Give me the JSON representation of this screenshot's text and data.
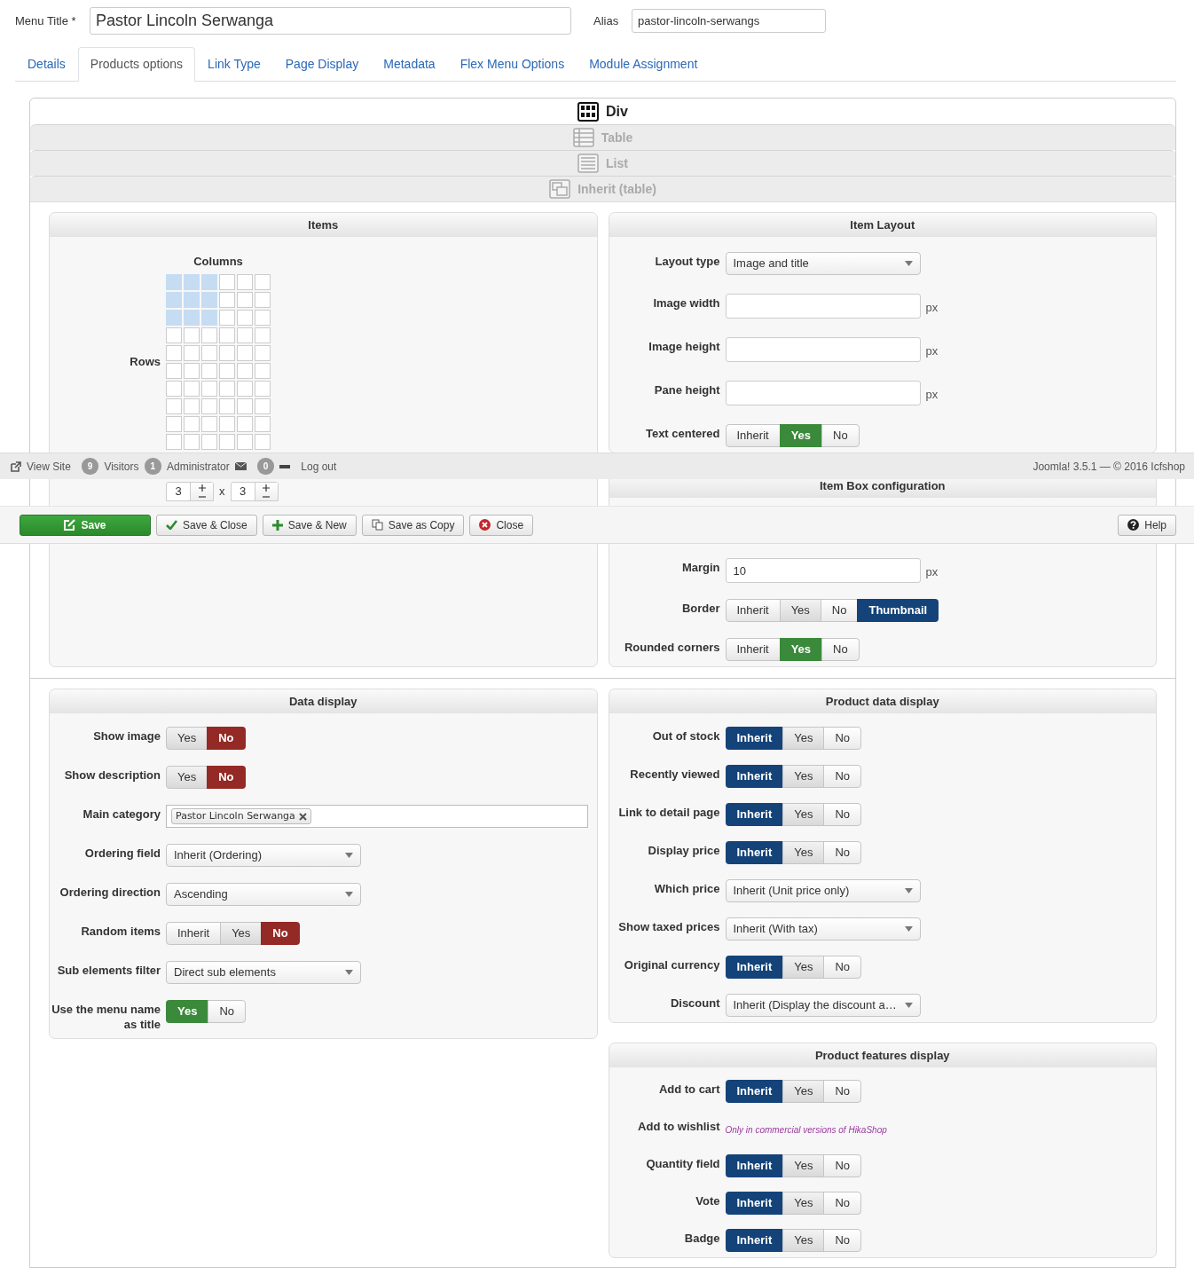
{
  "menu_title": {
    "label": "Menu Title *",
    "value": "Pastor Lincoln Serwanga"
  },
  "alias": {
    "label": "Alias",
    "value": "pastor-lincoln-serwangs"
  },
  "tabs": [
    {
      "label": "Details",
      "selected": false
    },
    {
      "label": "Products options",
      "selected": true
    },
    {
      "label": "Link Type",
      "selected": false
    },
    {
      "label": "Page Display",
      "selected": false
    },
    {
      "label": "Metadata",
      "selected": false
    },
    {
      "label": "Flex Menu Options",
      "selected": false
    },
    {
      "label": "Module Assignment",
      "selected": false
    }
  ],
  "layout_options": [
    {
      "kind": "div",
      "label": "Div",
      "selected": true
    },
    {
      "kind": "table",
      "label": "Table",
      "selected": false
    },
    {
      "kind": "list",
      "label": "List",
      "selected": false
    },
    {
      "kind": "inherit",
      "label": "Inherit (table)",
      "selected": false
    }
  ],
  "items_panel": {
    "title": "Items",
    "columns_label": "Columns",
    "rows_label": "Rows",
    "rows_value": "3",
    "times": "x",
    "columns_value": "3"
  },
  "item_layout": {
    "title": "Item Layout",
    "fields": [
      {
        "kind": "select",
        "label": "Layout type",
        "value": "Image and title"
      },
      {
        "kind": "text",
        "label": "Image width",
        "unit": "px"
      },
      {
        "kind": "text",
        "label": "Image height",
        "unit": "px"
      },
      {
        "kind": "text",
        "label": "Pane height",
        "unit": "px"
      },
      {
        "kind": "toggle",
        "label": "Text centered",
        "options": [
          {
            "label": "Inherit",
            "kind": "inherit",
            "selected": false
          },
          {
            "label": "Yes",
            "kind": "yes",
            "selected": true
          },
          {
            "label": "No",
            "kind": "no",
            "selected": false
          }
        ]
      }
    ]
  },
  "item_box": {
    "title": "Item Box configuration",
    "fields": [
      {
        "kind": "text",
        "label": "Margin",
        "value": "10",
        "unit": "px"
      },
      {
        "kind": "toggle",
        "label": "Border",
        "options": [
          {
            "label": "Inherit",
            "kind": "inherit",
            "selected": false
          },
          {
            "label": "Yes",
            "kind": "yes",
            "selected": false
          },
          {
            "label": "No",
            "kind": "no",
            "selected": false
          },
          {
            "label": "Thumbnail",
            "kind": "inherit",
            "selected": true
          }
        ]
      },
      {
        "kind": "toggle",
        "label": "Rounded corners",
        "options": [
          {
            "label": "Inherit",
            "kind": "inherit",
            "selected": false
          },
          {
            "label": "Yes",
            "kind": "yes",
            "selected": true
          },
          {
            "label": "No",
            "kind": "no",
            "selected": false
          }
        ]
      }
    ]
  },
  "data_display": {
    "title": "Data display",
    "fields": [
      {
        "kind": "toggle",
        "label": "Show image",
        "options": [
          {
            "label": "Yes",
            "kind": "yes",
            "selected": false
          },
          {
            "label": "No",
            "kind": "no",
            "selected": true
          }
        ]
      },
      {
        "kind": "toggle",
        "label": "Show description",
        "options": [
          {
            "label": "Yes",
            "kind": "yes",
            "selected": false
          },
          {
            "label": "No",
            "kind": "no",
            "selected": true
          }
        ]
      },
      {
        "kind": "tags",
        "label": "Main category",
        "tags": [
          "Pastor Lincoln Serwanga"
        ]
      },
      {
        "kind": "select",
        "label": "Ordering field",
        "value": "Inherit (Ordering)"
      },
      {
        "kind": "select",
        "label": "Ordering direction",
        "value": "Ascending"
      },
      {
        "kind": "toggle",
        "label": "Random items",
        "options": [
          {
            "label": "Inherit",
            "kind": "inherit",
            "selected": false
          },
          {
            "label": "Yes",
            "kind": "yes",
            "selected": false
          },
          {
            "label": "No",
            "kind": "no",
            "selected": true
          }
        ]
      },
      {
        "kind": "select",
        "label": "Sub elements filter",
        "value": "Direct sub elements"
      },
      {
        "kind": "toggle",
        "label": "Use the menu name as title",
        "options": [
          {
            "label": "Yes",
            "kind": "yes",
            "selected": true
          },
          {
            "label": "No",
            "kind": "no",
            "selected": false
          }
        ]
      }
    ]
  },
  "product_data_display": {
    "title": "Product data display",
    "fields": [
      {
        "kind": "toggle",
        "label": "Out of stock",
        "options": [
          {
            "label": "Inherit",
            "kind": "inherit",
            "selected": true
          },
          {
            "label": "Yes",
            "kind": "yes",
            "selected": false
          },
          {
            "label": "No",
            "kind": "no",
            "selected": false
          }
        ]
      },
      {
        "kind": "toggle",
        "label": "Recently viewed",
        "options": [
          {
            "label": "Inherit",
            "kind": "inherit",
            "selected": true
          },
          {
            "label": "Yes",
            "kind": "yes",
            "selected": false
          },
          {
            "label": "No",
            "kind": "no",
            "selected": false
          }
        ]
      },
      {
        "kind": "toggle",
        "label": "Link to detail page",
        "options": [
          {
            "label": "Inherit",
            "kind": "inherit",
            "selected": true
          },
          {
            "label": "Yes",
            "kind": "yes",
            "selected": false
          },
          {
            "label": "No",
            "kind": "no",
            "selected": false
          }
        ]
      },
      {
        "kind": "toggle",
        "label": "Display price",
        "options": [
          {
            "label": "Inherit",
            "kind": "inherit",
            "selected": true
          },
          {
            "label": "Yes",
            "kind": "yes",
            "selected": false
          },
          {
            "label": "No",
            "kind": "no",
            "selected": false
          }
        ]
      },
      {
        "kind": "select",
        "label": "Which price",
        "value": "Inherit (Unit price only)"
      },
      {
        "kind": "select",
        "label": "Show taxed prices",
        "value": "Inherit (With tax)"
      },
      {
        "kind": "toggle",
        "label": "Original currency",
        "options": [
          {
            "label": "Inherit",
            "kind": "inherit",
            "selected": true
          },
          {
            "label": "Yes",
            "kind": "yes",
            "selected": false
          },
          {
            "label": "No",
            "kind": "no",
            "selected": false
          }
        ]
      },
      {
        "kind": "select",
        "label": "Discount",
        "value": "Inherit (Display the discount a…"
      }
    ]
  },
  "product_features_display": {
    "title": "Product features display",
    "fields": [
      {
        "kind": "toggle",
        "label": "Add to cart",
        "options": [
          {
            "label": "Inherit",
            "kind": "inherit",
            "selected": true
          },
          {
            "label": "Yes",
            "kind": "yes",
            "selected": false
          },
          {
            "label": "No",
            "kind": "no",
            "selected": false
          }
        ]
      },
      {
        "kind": "note",
        "label": "Add to wishlist",
        "value": "Only in commercial versions of HikaShop"
      },
      {
        "kind": "toggle",
        "label": "Quantity field",
        "options": [
          {
            "label": "Inherit",
            "kind": "inherit",
            "selected": true
          },
          {
            "label": "Yes",
            "kind": "yes",
            "selected": false
          },
          {
            "label": "No",
            "kind": "no",
            "selected": false
          }
        ]
      },
      {
        "kind": "toggle",
        "label": "Vote",
        "options": [
          {
            "label": "Inherit",
            "kind": "inherit",
            "selected": true
          },
          {
            "label": "Yes",
            "kind": "yes",
            "selected": false
          },
          {
            "label": "No",
            "kind": "no",
            "selected": false
          }
        ]
      },
      {
        "kind": "toggle",
        "label": "Badge",
        "options": [
          {
            "label": "Inherit",
            "kind": "inherit",
            "selected": true
          },
          {
            "label": "Yes",
            "kind": "yes",
            "selected": false
          },
          {
            "label": "No",
            "kind": "no",
            "selected": false
          }
        ]
      }
    ]
  },
  "status_bar": {
    "view_site": "View Site",
    "visitors_count": "9",
    "visitors_label": "Visitors",
    "admins_count": "1",
    "admins_label": "Administrator",
    "messages_count": "0",
    "logout": "Log out",
    "version": "Joomla! 3.5.1 — © 2016 Icfshop"
  },
  "toolbar": [
    {
      "kind": "save",
      "label": "Save"
    },
    {
      "kind": "save_close",
      "label": "Save & Close"
    },
    {
      "kind": "save_new",
      "label": "Save & New"
    },
    {
      "kind": "save_copy",
      "label": "Save as Copy"
    },
    {
      "kind": "close",
      "label": "Close"
    },
    {
      "kind": "help",
      "label": "Help"
    }
  ]
}
